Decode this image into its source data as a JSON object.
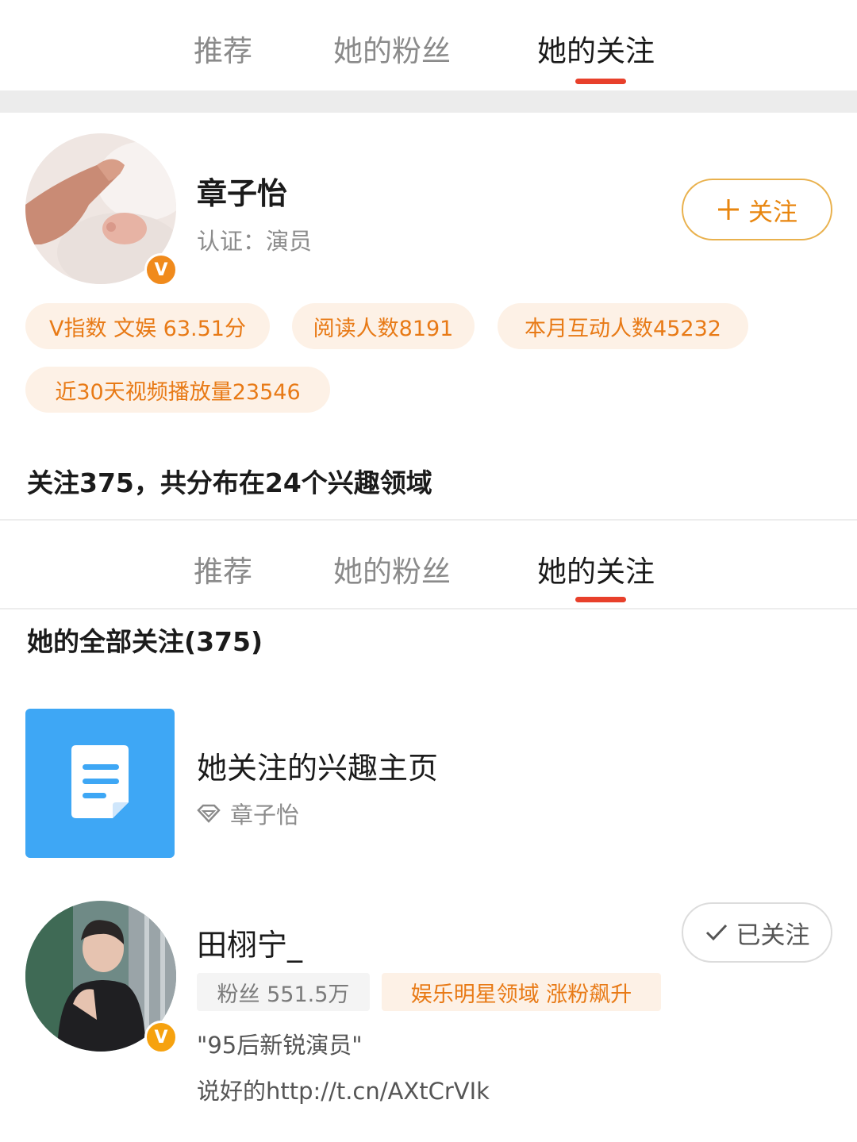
{
  "tabs": [
    {
      "label": "推荐"
    },
    {
      "label": "她的粉丝"
    },
    {
      "label": "她的关注"
    }
  ],
  "profile": {
    "name": "章子怡",
    "verification": "认证：演员",
    "verified_mark": "V",
    "follow_button": "关注",
    "chips": [
      "V指数 文娱 63.51分",
      "阅读人数8191",
      "本月互动人数45232",
      "近30天视频播放量23546"
    ]
  },
  "summary": "关注375，共分布在24个兴趣领域",
  "list": {
    "title": "她的全部关注(375)",
    "items": [
      {
        "title": "她关注的兴趣主页",
        "owner": "章子怡"
      },
      {
        "name": "田栩宁_",
        "verified_mark": "V",
        "followed_button": "已关注",
        "fans": "粉丝 551.5万",
        "tag": "娱乐明星领域 涨粉飙升",
        "intro": "\"95后新锐演员\"",
        "link_text": "说好的http://t.cn/AXtCrVIk"
      }
    ]
  },
  "colors": {
    "accent": "#e8402b",
    "orange": "#e87a16",
    "chip_bg": "#fdf1e6",
    "doc_tile": "#3ea7f5"
  },
  "icons": [
    "plus-icon",
    "check-icon",
    "verified-icon",
    "document-icon",
    "diamond-icon"
  ]
}
